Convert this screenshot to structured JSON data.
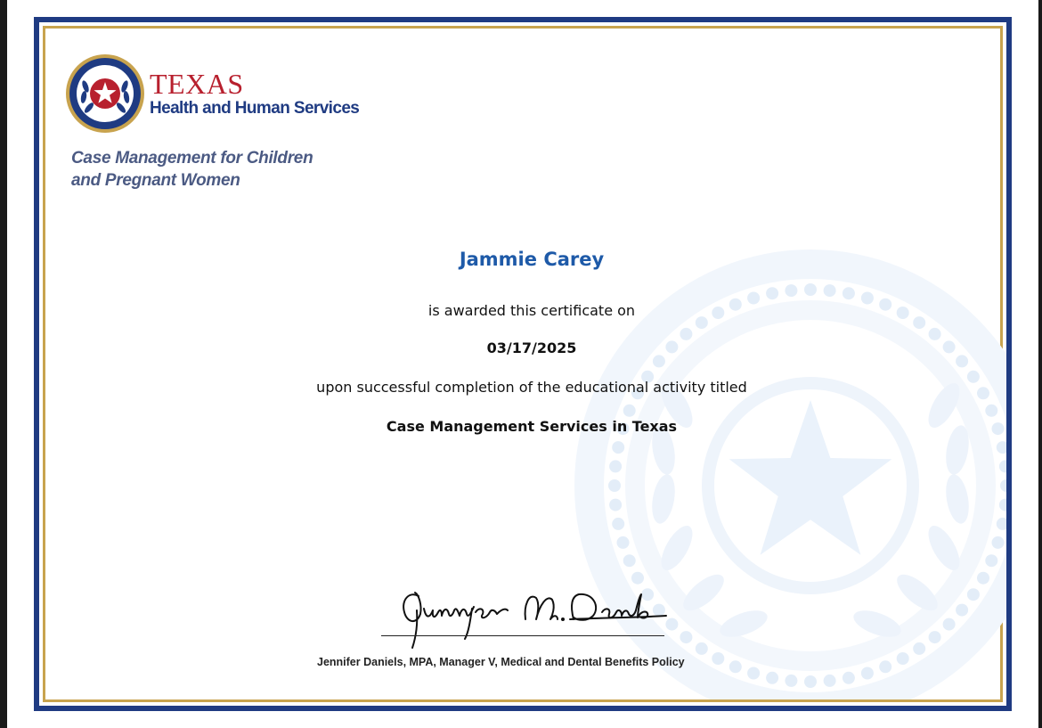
{
  "logo": {
    "title": "TEXAS",
    "subtitle": "Health and Human Services",
    "icon": "texas-state-seal-icon"
  },
  "program": {
    "line1": "Case Management for Children",
    "line2": "and Pregnant Women"
  },
  "certificate": {
    "recipient": "Jammie Carey",
    "awarded_text": "is awarded this certificate on",
    "date": "03/17/2025",
    "completion_text": "upon successful completion of the educational activity titled",
    "course_title": "Case Management Services in Texas"
  },
  "signatory": {
    "signature_name": "Jennifer M. Daniels",
    "printed": "Jennifer Daniels, MPA, Manager V, Medical and Dental Benefits Policy"
  },
  "colors": {
    "frame_blue": "#1f3b82",
    "frame_gold": "#c8a34e",
    "brand_red": "#b8202e",
    "recipient_blue": "#1e5aa8",
    "watermark": "#e9f1fa"
  }
}
